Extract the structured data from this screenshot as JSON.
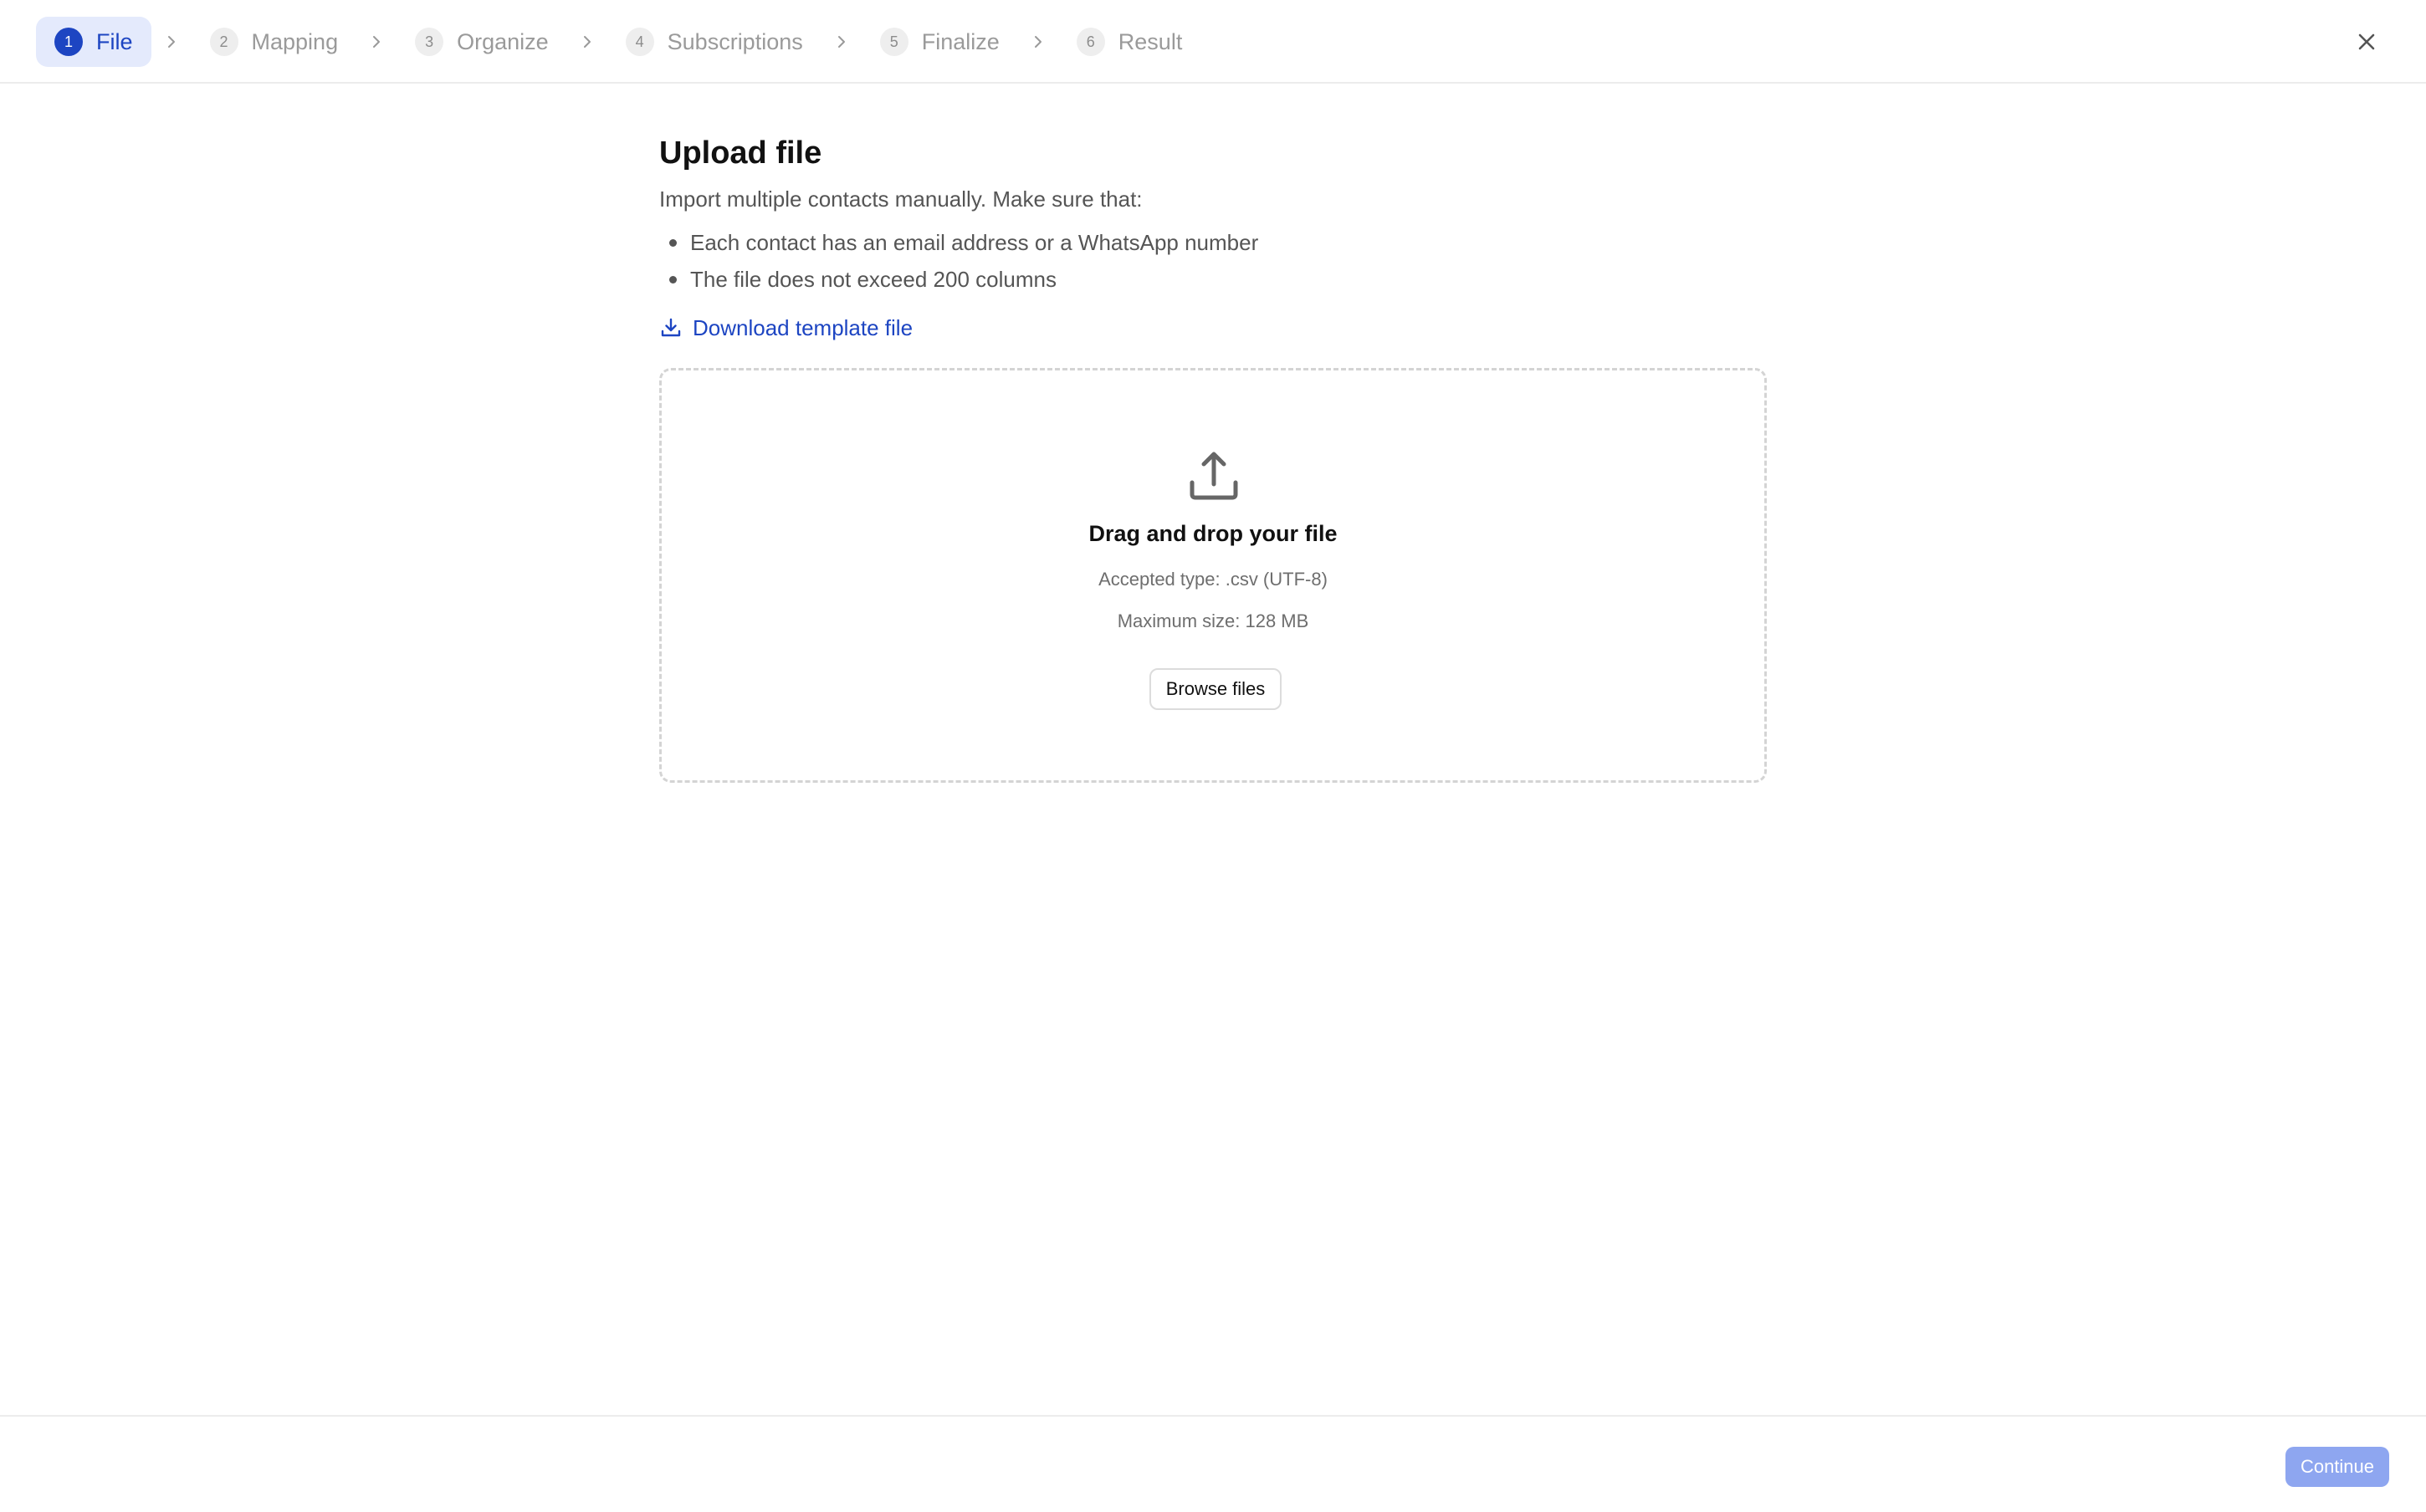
{
  "stepper": {
    "steps": [
      {
        "num": "1",
        "label": "File",
        "state": "active"
      },
      {
        "num": "2",
        "label": "Mapping",
        "state": "inactive"
      },
      {
        "num": "3",
        "label": "Organize",
        "state": "inactive"
      },
      {
        "num": "4",
        "label": "Subscriptions",
        "state": "inactive"
      },
      {
        "num": "5",
        "label": "Finalize",
        "state": "inactive"
      },
      {
        "num": "6",
        "label": "Result",
        "state": "inactive"
      }
    ],
    "separator_icon": "chevron-right-icon",
    "close_icon": "close-icon"
  },
  "main": {
    "title": "Upload file",
    "intro": "Import multiple contacts manually. Make sure that:",
    "rules": [
      "Each contact has an email address or a WhatsApp number",
      "The file does not exceed 200 columns"
    ],
    "download_label": "Download template file",
    "download_icon": "download-icon"
  },
  "dropzone": {
    "icon": "upload-icon",
    "title": "Drag and drop your file",
    "accepted_type": "Accepted type: .csv (UTF-8)",
    "max_size": "Maximum size: 128 MB",
    "browse_label": "Browse files"
  },
  "footer": {
    "continue_label": "Continue"
  },
  "colors": {
    "accent": "#1d45c2",
    "active_step_bg": "#e4eafc",
    "continue_disabled_bg": "#8ea6f0"
  }
}
